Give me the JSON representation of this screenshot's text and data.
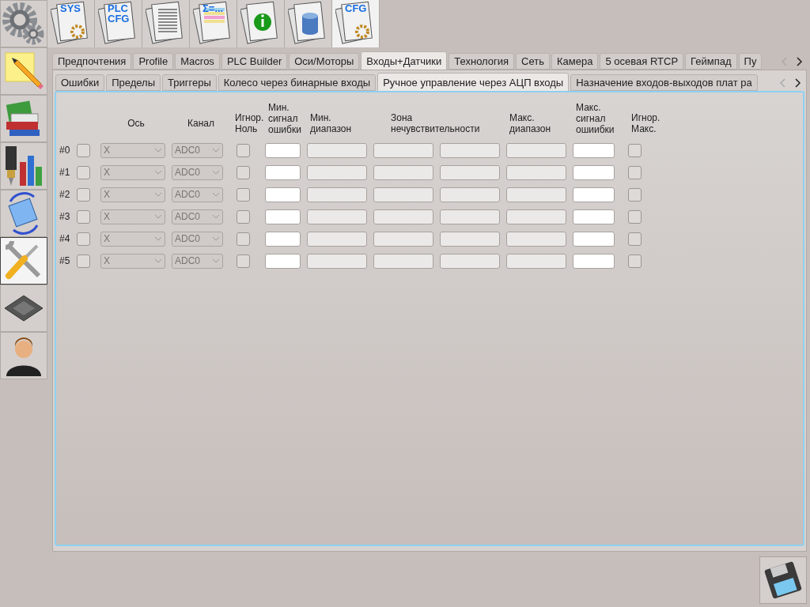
{
  "sidebar": {
    "items": [
      {
        "kind": "gear",
        "selected": false
      },
      {
        "kind": "note",
        "selected": false
      },
      {
        "kind": "books",
        "selected": false
      },
      {
        "kind": "chart",
        "selected": false
      },
      {
        "kind": "rotate",
        "selected": false
      },
      {
        "kind": "tools",
        "selected": true
      },
      {
        "kind": "chip",
        "selected": false
      },
      {
        "kind": "user",
        "selected": false
      }
    ]
  },
  "toolbar": {
    "items": [
      {
        "kind": "gear",
        "label": "SYS",
        "selected": false
      },
      {
        "kind": "plain",
        "label": "PLC\nCFG",
        "selected": false
      },
      {
        "kind": "lines",
        "selected": false
      },
      {
        "kind": "table",
        "label": "Σ=...",
        "selected": false
      },
      {
        "kind": "info",
        "selected": false
      },
      {
        "kind": "database",
        "selected": false
      },
      {
        "kind": "gear",
        "label": "CFG",
        "selected": true
      }
    ]
  },
  "tabs": [
    {
      "label": "Предпочтения",
      "selected": false
    },
    {
      "label": "Profile",
      "selected": false
    },
    {
      "label": "Macros",
      "selected": false
    },
    {
      "label": "PLC Builder",
      "selected": false
    },
    {
      "label": "Оси/Моторы",
      "selected": false
    },
    {
      "label": "Входы+Датчики",
      "selected": true
    },
    {
      "label": "Технология",
      "selected": false
    },
    {
      "label": "Сеть",
      "selected": false
    },
    {
      "label": "Камера",
      "selected": false
    },
    {
      "label": "5 осевая RTCP",
      "selected": false
    },
    {
      "label": "Геймпад",
      "selected": false
    },
    {
      "label": "Пу",
      "selected": false
    }
  ],
  "subtabs": [
    {
      "label": "Ошибки",
      "selected": false
    },
    {
      "label": "Пределы",
      "selected": false
    },
    {
      "label": "Триггеры",
      "selected": false
    },
    {
      "label": "Колесо через бинарные входы",
      "selected": false
    },
    {
      "label": "Ручное управление через АЦП входы",
      "selected": true
    },
    {
      "label": "Назначение входов-выходов плат ра",
      "selected": false
    }
  ],
  "table": {
    "columns": [
      "Ось",
      "Канал",
      "Игнор.\nНоль",
      "Мин.\nсигнал\nошибки",
      "Мин.\nдиапазон",
      "Зона\nнечувствительности",
      "Макс.\nдиапазон",
      "Макс.\nсигнал\nошиибки",
      "Игнор.\nМакс."
    ],
    "rows": [
      {
        "label": "#0",
        "enabled": false,
        "axis": "X",
        "channel": "ADC0",
        "combos_disabled": true,
        "ignore_zero": false,
        "fields": [
          {
            "disabled": false
          },
          {
            "disabled": true
          },
          {
            "disabled": true
          },
          {
            "disabled": true
          },
          {
            "disabled": true
          },
          {
            "disabled": false
          }
        ],
        "ignore_max": false
      },
      {
        "label": "#1",
        "enabled": false,
        "axis": "X",
        "channel": "ADC0",
        "combos_disabled": true,
        "ignore_zero": false,
        "fields": [
          {
            "disabled": false
          },
          {
            "disabled": true
          },
          {
            "disabled": true
          },
          {
            "disabled": true
          },
          {
            "disabled": true
          },
          {
            "disabled": false
          }
        ],
        "ignore_max": false
      },
      {
        "label": "#2",
        "enabled": false,
        "axis": "X",
        "channel": "ADC0",
        "combos_disabled": true,
        "ignore_zero": false,
        "fields": [
          {
            "disabled": false
          },
          {
            "disabled": true
          },
          {
            "disabled": true
          },
          {
            "disabled": true
          },
          {
            "disabled": true
          },
          {
            "disabled": false
          }
        ],
        "ignore_max": false
      },
      {
        "label": "#3",
        "enabled": false,
        "axis": "X",
        "channel": "ADC0",
        "combos_disabled": true,
        "ignore_zero": false,
        "fields": [
          {
            "disabled": false
          },
          {
            "disabled": true
          },
          {
            "disabled": true
          },
          {
            "disabled": true
          },
          {
            "disabled": true
          },
          {
            "disabled": false
          }
        ],
        "ignore_max": false
      },
      {
        "label": "#4",
        "enabled": false,
        "axis": "X",
        "channel": "ADC0",
        "combos_disabled": true,
        "ignore_zero": false,
        "fields": [
          {
            "disabled": false
          },
          {
            "disabled": true
          },
          {
            "disabled": true
          },
          {
            "disabled": true
          },
          {
            "disabled": true
          },
          {
            "disabled": false
          }
        ],
        "ignore_max": false
      },
      {
        "label": "#5",
        "enabled": false,
        "axis": "X",
        "channel": "ADC0",
        "combos_disabled": true,
        "ignore_zero": false,
        "fields": [
          {
            "disabled": false
          },
          {
            "disabled": true
          },
          {
            "disabled": true
          },
          {
            "disabled": true
          },
          {
            "disabled": true
          },
          {
            "disabled": false
          }
        ],
        "ignore_max": false
      }
    ]
  }
}
